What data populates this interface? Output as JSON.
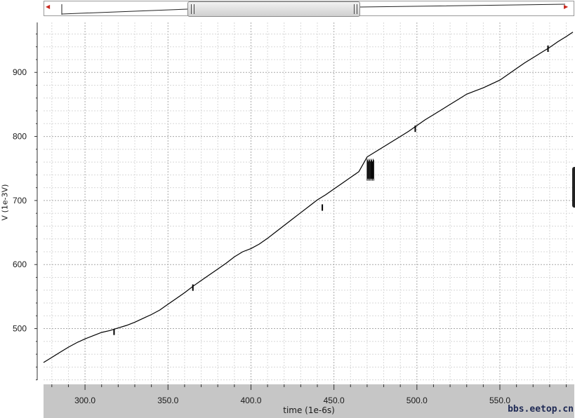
{
  "chart_data": {
    "type": "line",
    "xlabel": "time (1e-6s)",
    "ylabel": "V (1e-3V)",
    "xlim": [
      275,
      594
    ],
    "ylim": [
      413,
      978
    ],
    "x_ticks": [
      "300.0",
      "350.0",
      "400.0",
      "450.0",
      "500.0",
      "550.0"
    ],
    "y_ticks": [
      "500",
      "600",
      "700",
      "800",
      "900"
    ],
    "grid": true,
    "line_color": "#000000",
    "series": [
      {
        "x": [
          275,
          280,
          285,
          290,
          295,
          300,
          305,
          310,
          315,
          320,
          325,
          330,
          335,
          340,
          345,
          350,
          355,
          360,
          365,
          370,
          375,
          380,
          385,
          390,
          395,
          400,
          405,
          410,
          415,
          420,
          425,
          430,
          435,
          440,
          445,
          450,
          455,
          460,
          465,
          470,
          475,
          480,
          485,
          490,
          495,
          500,
          505,
          510,
          515,
          520,
          525,
          530,
          535,
          540,
          545,
          550,
          555,
          560,
          565,
          570,
          575,
          580,
          585,
          590,
          594
        ],
        "y": [
          447,
          455,
          463,
          471,
          478,
          484,
          489,
          494,
          497,
          501,
          505,
          510,
          516,
          522,
          529,
          538,
          547,
          556,
          566,
          575,
          584,
          593,
          602,
          612,
          620,
          625,
          632,
          641,
          651,
          661,
          671,
          681,
          691,
          701,
          709,
          718,
          727,
          736,
          745,
          768,
          776,
          784,
          792,
          800,
          808,
          817,
          826,
          834,
          842,
          850,
          858,
          866,
          871,
          876,
          882,
          888,
          897,
          906,
          915,
          923,
          931,
          939,
          948,
          956,
          963
        ]
      }
    ],
    "spikes": [
      {
        "x": 317.5,
        "y_low": 490,
        "y_high": 499
      },
      {
        "x": 365.0,
        "y_low": 559,
        "y_high": 569
      },
      {
        "x": 443.0,
        "y_low": 684,
        "y_high": 694
      },
      {
        "x": 499.0,
        "y_low": 807,
        "y_high": 817
      },
      {
        "x": 579.0,
        "y_low": 932,
        "y_high": 942
      }
    ],
    "glitch_burst": {
      "x_start": 470,
      "x_end": 474,
      "y_low": 731,
      "y_high": 765
    }
  },
  "watermark": "bbs.eetop.cn",
  "scrollbar": {
    "left_arrow": "◀",
    "right_arrow": "▶"
  }
}
